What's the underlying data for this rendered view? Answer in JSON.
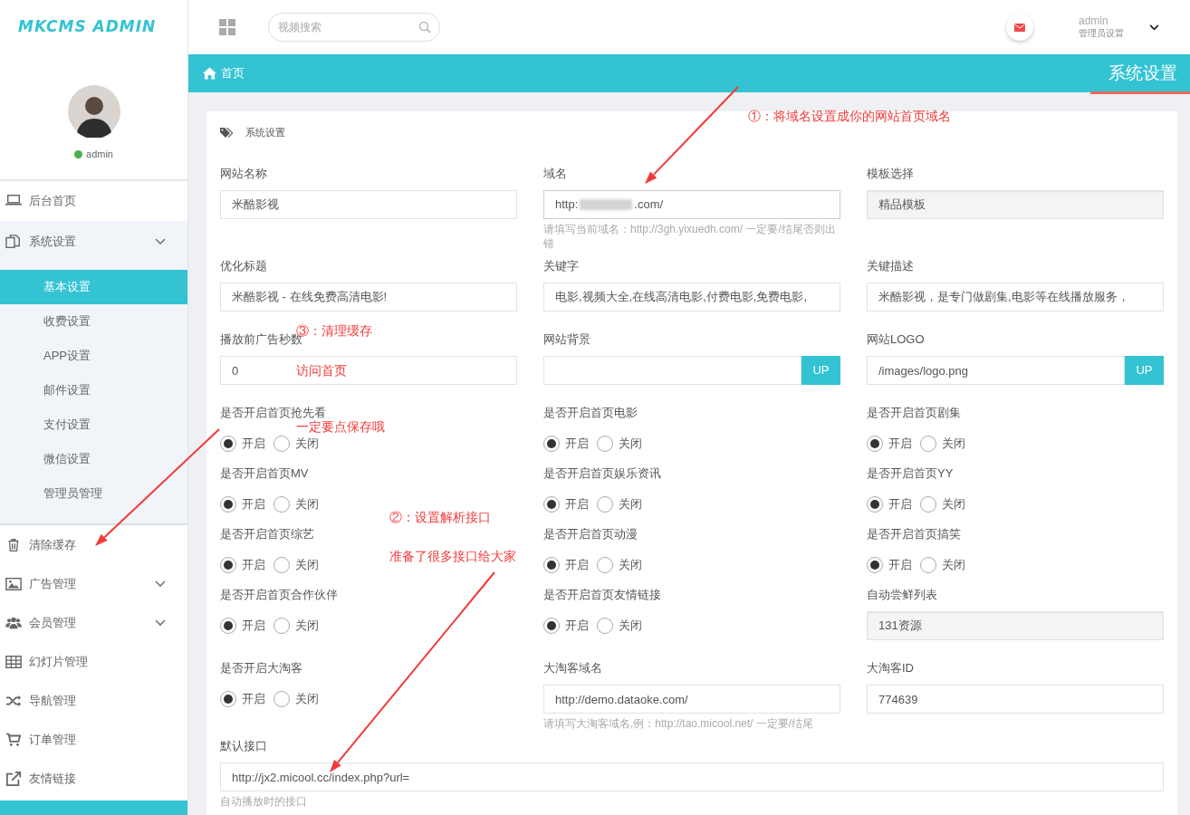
{
  "logo": "MKCMS ADMIN",
  "header": {
    "search": {
      "placeholder": "视频搜索"
    },
    "user": {
      "name": "admin",
      "role": "管理员设置"
    }
  },
  "profile": {
    "name": "admin",
    "online": true
  },
  "sidebar": {
    "items": [
      {
        "label": "后台首页",
        "kind": "link"
      },
      {
        "label": "系统设置",
        "kind": "group",
        "expanded": true,
        "children": [
          {
            "label": "基本设置",
            "selected": true
          },
          {
            "label": "收费设置",
            "selected": false
          },
          {
            "label": "APP设置",
            "selected": false
          },
          {
            "label": "邮件设置",
            "selected": false
          },
          {
            "label": "支付设置",
            "selected": false
          },
          {
            "label": "微信设置",
            "selected": false
          },
          {
            "label": "管理员管理",
            "selected": false
          }
        ]
      },
      {
        "label": "清除缓存",
        "kind": "link"
      },
      {
        "label": "广告管理",
        "kind": "group"
      },
      {
        "label": "会员管理",
        "kind": "group"
      },
      {
        "label": "幻灯片管理",
        "kind": "link"
      },
      {
        "label": "导航管理",
        "kind": "link"
      },
      {
        "label": "订单管理",
        "kind": "link"
      },
      {
        "label": "友情链接",
        "kind": "link"
      }
    ]
  },
  "breadcrumb": "首页",
  "page_title": "系统设置",
  "card_title": "系统设置",
  "fields": [
    {
      "label": "网站名称",
      "kind": "text",
      "value": "米酷影视"
    },
    {
      "label": "域名",
      "kind": "redacted",
      "value": "http:",
      "value_end": ".com/",
      "hint": "请填写当前域名：http://3gh.yixuedh.com/ 一定要/结尾否则出错"
    },
    {
      "label": "模板选择",
      "kind": "select",
      "value": "精品模板"
    },
    {
      "label": "优化标题",
      "kind": "text",
      "value": "米酷影视 - 在线免费高清电影!"
    },
    {
      "label": "关键字",
      "kind": "text",
      "value": "电影,视频大全,在线高清电影,付费电影,免费电影,"
    },
    {
      "label": "关键描述",
      "kind": "text",
      "value": "米酷影视，是专门做剧集,电影等在线播放服务，"
    },
    {
      "label": "播放前广告秒数",
      "kind": "text",
      "value": "0"
    },
    {
      "label": "网站背景",
      "kind": "upload",
      "button": "UP"
    },
    {
      "label": "网站LOGO",
      "kind": "upload",
      "value": "/images/logo.png",
      "button": "UP"
    },
    {
      "label": "是否开启首页抢先看",
      "kind": "radio",
      "options": [
        {
          "label": "开启",
          "selected": true
        },
        {
          "label": "关闭",
          "selected": false
        }
      ]
    },
    {
      "label": "是否开启首页电影",
      "kind": "radio",
      "options": [
        {
          "label": "开启",
          "selected": true
        },
        {
          "label": "关闭",
          "selected": false
        }
      ]
    },
    {
      "label": "是否开启首页剧集",
      "kind": "radio",
      "options": [
        {
          "label": "开启",
          "selected": true
        },
        {
          "label": "关闭",
          "selected": false
        }
      ]
    },
    {
      "label": "是否开启首页MV",
      "kind": "radio",
      "options": [
        {
          "label": "开启",
          "selected": true
        },
        {
          "label": "关闭",
          "selected": false
        }
      ]
    },
    {
      "label": "是否开启首页娱乐资讯",
      "kind": "radio",
      "options": [
        {
          "label": "开启",
          "selected": true
        },
        {
          "label": "关闭",
          "selected": false
        }
      ]
    },
    {
      "label": "是否开启首页YY",
      "kind": "radio",
      "options": [
        {
          "label": "开启",
          "selected": true
        },
        {
          "label": "关闭",
          "selected": false
        }
      ]
    },
    {
      "label": "是否开启首页综艺",
      "kind": "radio",
      "options": [
        {
          "label": "开启",
          "selected": true
        },
        {
          "label": "关闭",
          "selected": false
        }
      ]
    },
    {
      "label": "是否开启首页动漫",
      "kind": "radio",
      "options": [
        {
          "label": "开启",
          "selected": true
        },
        {
          "label": "关闭",
          "selected": false
        }
      ]
    },
    {
      "label": "是否开启首页搞笑",
      "kind": "radio",
      "options": [
        {
          "label": "开启",
          "selected": true
        },
        {
          "label": "关闭",
          "selected": false
        }
      ]
    },
    {
      "label": "是否开启首页合作伙伴",
      "kind": "radio",
      "options": [
        {
          "label": "开启",
          "selected": true
        },
        {
          "label": "关闭",
          "selected": false
        }
      ]
    },
    {
      "label": "是否开启首页友情链接",
      "kind": "radio",
      "options": [
        {
          "label": "开启",
          "selected": true
        },
        {
          "label": "关闭",
          "selected": false
        }
      ]
    },
    {
      "label": "自动尝鲜列表",
      "kind": "select",
      "value": "131资源"
    },
    {
      "label": "是否开启大淘客",
      "kind": "radio",
      "options": [
        {
          "label": "开启",
          "selected": true
        },
        {
          "label": "关闭",
          "selected": false
        }
      ]
    },
    {
      "label": "大淘客域名",
      "kind": "text",
      "value": "http://demo.dataoke.com/",
      "hint": "请填写大淘客域名,例：http://tao.micool.net/ 一定要/结尾"
    },
    {
      "label": "大淘客ID",
      "kind": "text",
      "value": "774639"
    },
    {
      "label": "默认接口",
      "kind": "wide",
      "value": "http://jx2.micool.cc/index.php?url=",
      "hint": "自动播放时的接口"
    }
  ],
  "annotations": [
    "①：将域名设置成你的网站首页域名",
    "③：清理缓存",
    "访问首页",
    "一定要点保存哦",
    "②：设置解析接口",
    "准备了很多接口给大家"
  ]
}
